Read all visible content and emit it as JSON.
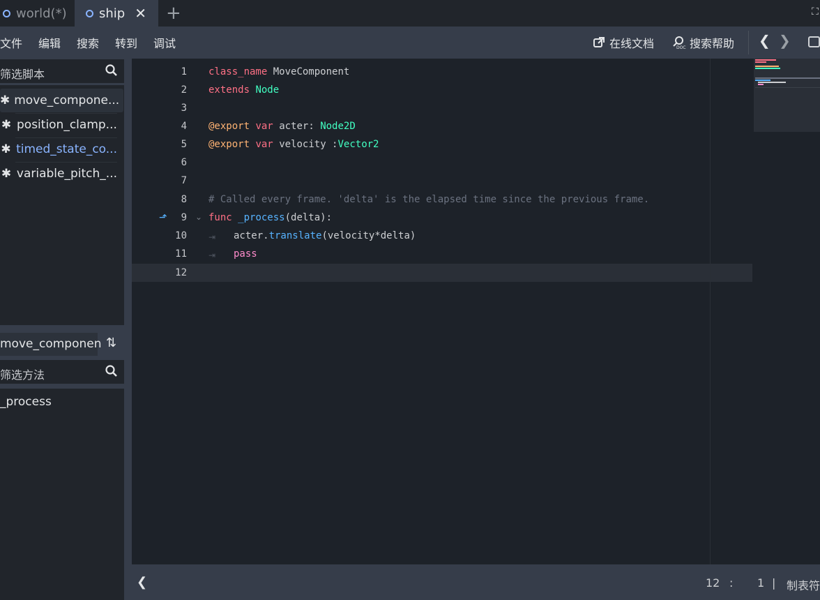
{
  "tabs": [
    {
      "label": "world(*)"
    },
    {
      "label": "ship"
    }
  ],
  "menu": [
    "文件",
    "编辑",
    "搜索",
    "转到",
    "调试"
  ],
  "toolbar": {
    "online_docs": "在线文档",
    "search_help": "搜索帮助"
  },
  "scripts_filter": {
    "placeholder": "筛选脚本"
  },
  "scripts": [
    {
      "name": "move_compone..."
    },
    {
      "name": "position_clamp..."
    },
    {
      "name": "timed_state_co..."
    },
    {
      "name": "variable_pitch_..."
    }
  ],
  "current_script": "move_componen",
  "methods_filter": {
    "placeholder": "筛选方法"
  },
  "methods": [
    "_process"
  ],
  "code_lines": [
    {
      "n": "1"
    },
    {
      "n": "2"
    },
    {
      "n": "3"
    },
    {
      "n": "4"
    },
    {
      "n": "5"
    },
    {
      "n": "6"
    },
    {
      "n": "7"
    },
    {
      "n": "8"
    },
    {
      "n": "9"
    },
    {
      "n": "10"
    },
    {
      "n": "11"
    },
    {
      "n": "12"
    }
  ],
  "code": {
    "l1a": "class_name",
    "l1b": "MoveComponent",
    "l2a": "extends",
    "l2b": "Node",
    "l4a": "@export",
    "l4b": "var",
    "l4c": "acter:",
    "l4d": "Node2D",
    "l5a": "@export",
    "l5b": "var",
    "l5c": "velocity :",
    "l5d": "Vector2",
    "l8": "# Called every frame. 'delta' is the elapsed time since the previous frame.",
    "l9a": "func",
    "l9b": "_process",
    "l9c": "(delta):",
    "l10a": "acter.",
    "l10b": "translate",
    "l10c": "(velocity*delta)",
    "l11": "pass"
  },
  "status": {
    "line": "12",
    "col_sep": ":",
    "col": "1",
    "bar": "|",
    "indent": "制表符"
  },
  "colors": {
    "accent": "#8ab4ff",
    "keyword": "#ff7085",
    "type": "#42ffc2",
    "function": "#57b3ff",
    "annotation": "#ffb373"
  }
}
